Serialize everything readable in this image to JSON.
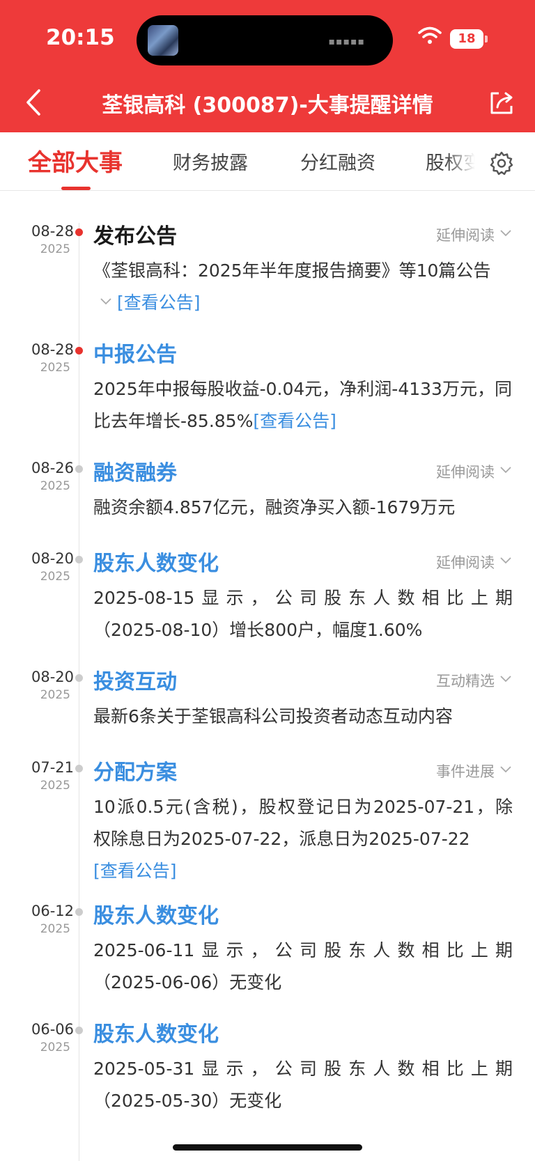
{
  "status": {
    "time": "20:15",
    "battery": "18"
  },
  "nav": {
    "title": "荃银高科 (300087)-大事提醒详情"
  },
  "tabs": [
    "全部大事",
    "财务披露",
    "分红融资",
    "股权变"
  ],
  "events": [
    {
      "date": "08-28",
      "year": "2025",
      "dot": "red",
      "title": "发布公告",
      "title_style": "dark",
      "more": "延伸阅读",
      "body": "《荃银高科：2025年半年度报告摘要》等10篇公告",
      "link": "[查看公告]"
    },
    {
      "date": "08-28",
      "year": "2025",
      "dot": "red",
      "title": "中报公告",
      "body": "2025年中报每股收益-0.04元，净利润-4133万元，同比去年增长-85.85%",
      "link": "[查看公告]"
    },
    {
      "date": "08-26",
      "year": "2025",
      "dot": "grey",
      "title": "融资融券",
      "more": "延伸阅读",
      "body": "融资余额4.857亿元，融资净买入额-1679万元"
    },
    {
      "date": "08-20",
      "year": "2025",
      "dot": "grey",
      "title": "股东人数变化",
      "more": "延伸阅读",
      "body_line1": "2025-08-15显示，公司股东人数相比上期",
      "body_line2": "（2025-08-10）增长800户，幅度1.60%"
    },
    {
      "date": "08-20",
      "year": "2025",
      "dot": "grey",
      "title": "投资互动",
      "more": "互动精选",
      "body": "最新6条关于荃银高科公司投资者动态互动内容"
    },
    {
      "date": "07-21",
      "year": "2025",
      "dot": "grey",
      "title": "分配方案",
      "more": "事件进展",
      "body_line1": "10派0.5元(含税)，股权登记日为2025-07-21，除",
      "body_line2": "权除息日为2025-07-22，派息日为2025-07-22",
      "link": "[查看公告]"
    },
    {
      "date": "06-12",
      "year": "2025",
      "dot": "grey",
      "title": "股东人数变化",
      "body_line1": "2025-06-11显示，公司股东人数相比上期",
      "body_line2": "（2025-06-06）无变化"
    },
    {
      "date": "06-06",
      "year": "2025",
      "dot": "grey",
      "title": "股东人数变化",
      "body_line1": "2025-05-31显示，公司股东人数相比上期",
      "body_line2": "（2025-05-30）无变化"
    }
  ],
  "colors": {
    "brand_red": "#ee3a3a",
    "link_blue": "#3a8ee0",
    "active_tab": "#e8332e"
  },
  "icons": {
    "back": "chevron-left-icon",
    "share": "share-icon",
    "settings": "gear-icon",
    "wifi": "wifi-icon",
    "expand": "chevron-down-icon"
  }
}
